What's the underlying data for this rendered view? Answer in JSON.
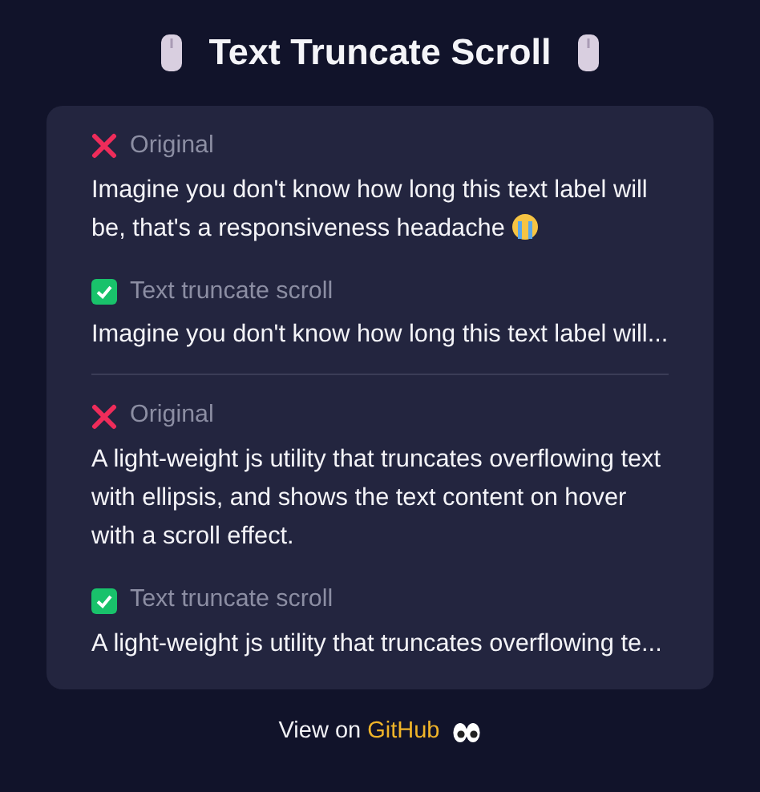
{
  "title": "Text Truncate Scroll",
  "sections": [
    {
      "items": [
        {
          "kind": "original",
          "label": "Original",
          "text": "Imagine you don't know how long this text label will be, that's a responsiveness headache",
          "has_emoji": true
        },
        {
          "kind": "truncated",
          "label": "Text truncate scroll",
          "text": "Imagine you don't know how long this text label will...",
          "has_emoji": false
        }
      ]
    },
    {
      "items": [
        {
          "kind": "original",
          "label": "Original",
          "text": "A light-weight js utility that truncates overflowing text with ellipsis, and shows the text content on hover with a scroll effect.",
          "has_emoji": false
        },
        {
          "kind": "truncated",
          "label": "Text truncate scroll",
          "text": "A light-weight js utility that truncates overflowing te...",
          "has_emoji": false
        }
      ]
    }
  ],
  "footer": {
    "text": "View on",
    "link": "GitHub"
  }
}
